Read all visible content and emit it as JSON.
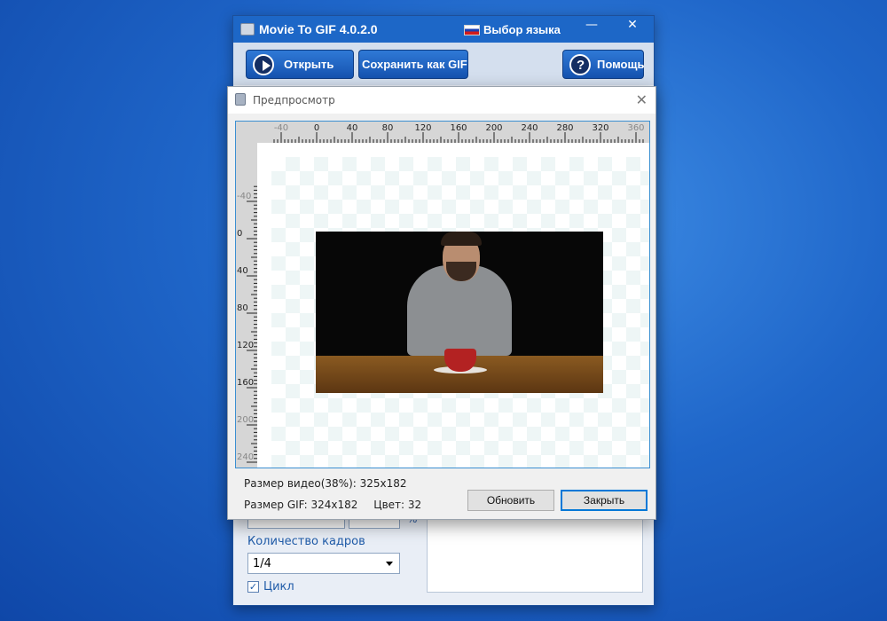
{
  "app": {
    "title": "Movie To GIF 4.0.2.0",
    "language_label": "Выбор языка",
    "icon": "film-strip-icon",
    "flag_icon": "russian-flag-icon",
    "title_bar_color": "#1d67c7"
  },
  "window_controls": {
    "minimize": "—",
    "close": "✕"
  },
  "toolbar": {
    "open_label": "Открыть",
    "save_label": "Сохранить как GIF",
    "help_label": "Помощь"
  },
  "main": {
    "frames_label": "Количество кадров",
    "frames_value": "1/4",
    "loop_label": "Цикл",
    "loop_checked": true,
    "percent_suffix": "%"
  },
  "preview": {
    "title": "Предпросмотр",
    "close_icon": "close-icon",
    "video_size_text": "Размер видео(38%): 325x182",
    "gif_size_text": "Размер GIF: 324x182",
    "colors_text": "Цвет: 32",
    "refresh_label": "Обновить",
    "close_label": "Закрыть",
    "ruler_h_labels": [
      "-40",
      "0",
      "40",
      "80",
      "120",
      "160",
      "200",
      "240",
      "280",
      "320",
      "360"
    ],
    "ruler_v_labels": [
      "-40",
      "0",
      "40",
      "80",
      "120",
      "160",
      "200",
      "240"
    ]
  }
}
